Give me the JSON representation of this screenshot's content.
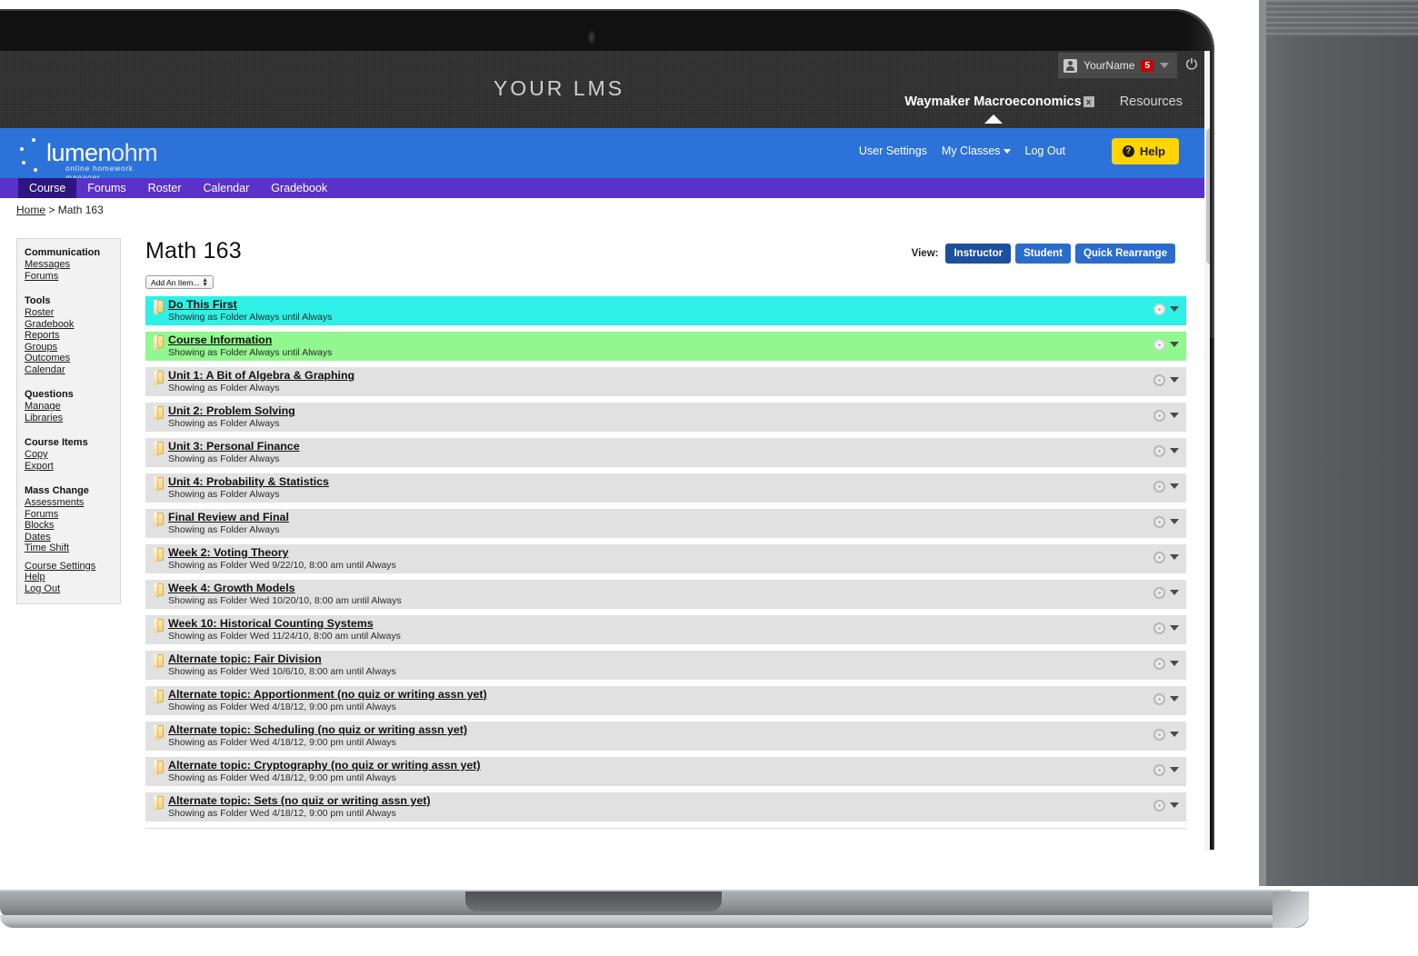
{
  "lms": {
    "title": "YOUR LMS",
    "user": {
      "name": "YourName",
      "badge": "5"
    },
    "icons": {
      "avatar": "avatar-icon",
      "power": "power-icon",
      "pin": "pin-icon",
      "caret": "chevron-down-icon"
    },
    "tabs": [
      {
        "label": "Waymaker Macroeconomics",
        "close": "x",
        "active": true
      },
      {
        "label": "Resources",
        "active": false
      }
    ]
  },
  "ohm": {
    "logo_main": "lumen",
    "logo_accent": "ohm",
    "logo_tagline": "online homework manager",
    "links": [
      {
        "label": "User Settings",
        "caret": false
      },
      {
        "label": "My Classes",
        "caret": true
      },
      {
        "label": "Log Out",
        "caret": false
      }
    ],
    "help_label": "Help"
  },
  "nav": {
    "items": [
      {
        "label": "Course",
        "active": true
      },
      {
        "label": "Forums",
        "active": false
      },
      {
        "label": "Roster",
        "active": false
      },
      {
        "label": "Calendar",
        "active": false
      },
      {
        "label": "Gradebook",
        "active": false
      }
    ]
  },
  "breadcrumb": {
    "home": "Home",
    "separator": " > ",
    "current": "Math 163"
  },
  "sidebar": {
    "groups": [
      {
        "heading": "Communication",
        "links": [
          "Messages",
          "Forums"
        ]
      },
      {
        "heading": "Tools",
        "links": [
          "Roster",
          "Gradebook",
          "Reports",
          "Groups",
          "Outcomes",
          "Calendar"
        ]
      },
      {
        "heading": "Questions",
        "links": [
          "Manage",
          "Libraries"
        ]
      },
      {
        "heading": "Course Items",
        "links": [
          "Copy",
          "Export"
        ]
      },
      {
        "heading": "Mass Change",
        "links": [
          "Assessments",
          "Forums",
          "Blocks",
          "Dates",
          "Time Shift"
        ]
      },
      {
        "heading": "",
        "links": [
          "Course Settings",
          "Help",
          "Log Out"
        ]
      }
    ]
  },
  "main": {
    "page_title": "Math 163",
    "view_label": "View:",
    "view_buttons": [
      {
        "label": "Instructor",
        "selected": true
      },
      {
        "label": "Student",
        "selected": false
      },
      {
        "label": "Quick Rearrange",
        "selected": false
      }
    ],
    "add_item": {
      "value": "Add An Item...",
      "placeholder": "Add An Item..."
    },
    "items": [
      {
        "title": "Do This First",
        "sub": "Showing as Folder Always until Always",
        "color": "cyan"
      },
      {
        "title": "Course Information",
        "sub": "Showing as Folder Always until Always",
        "color": "green"
      },
      {
        "title": "Unit 1: A Bit of Algebra & Graphing",
        "sub": "Showing as Folder Always",
        "color": ""
      },
      {
        "title": "Unit 2: Problem Solving ",
        "sub": "Showing as Folder Always",
        "color": ""
      },
      {
        "title": "Unit 3: Personal Finance",
        "sub": "Showing as Folder Always",
        "color": ""
      },
      {
        "title": "Unit 4: Probability & Statistics",
        "sub": "Showing as Folder Always",
        "color": ""
      },
      {
        "title": "Final Review and Final",
        "sub": "Showing as Folder Always",
        "color": ""
      },
      {
        "title": "Week 2: Voting Theory",
        "sub": "Showing as Folder Wed 9/22/10, 8:00 am until Always",
        "color": ""
      },
      {
        "title": "Week 4: Growth Models",
        "sub": "Showing as Folder Wed 10/20/10, 8:00 am until Always",
        "color": ""
      },
      {
        "title": "Week 10: Historical Counting Systems",
        "sub": "Showing as Folder Wed 11/24/10, 8:00 am until Always",
        "color": ""
      },
      {
        "title": "Alternate topic: Fair Division",
        "sub": "Showing as Folder Wed 10/6/10, 8:00 am until Always",
        "color": ""
      },
      {
        "title": "Alternate topic: Apportionment (no quiz or writing assn yet)",
        "sub": "Showing as Folder Wed 4/18/12, 9:00 pm until Always",
        "color": ""
      },
      {
        "title": "Alternate topic: Scheduling (no quiz or writing assn yet)",
        "sub": "Showing as Folder Wed 4/18/12, 9:00 pm until Always",
        "color": ""
      },
      {
        "title": "Alternate topic: Cryptography (no quiz or writing assn yet)",
        "sub": "Showing as Folder Wed 4/18/12, 9:00 pm until Always",
        "color": ""
      },
      {
        "title": "Alternate topic: Sets (no quiz or writing assn yet)",
        "sub": "Showing as Folder Wed 4/18/12, 9:00 pm until Always",
        "color": ""
      }
    ]
  },
  "colors": {
    "ohm_blue": "#2d72d9",
    "nav_purple": "#5b32c9",
    "nav_purple_active": "#2e1580",
    "help_yellow": "#ffd400",
    "badge_red": "#cc0000",
    "row_cyan": "#2ff0e6",
    "row_green": "#92f78f",
    "row_grey": "#e1e1e1",
    "view_blue": "#2a6ccc",
    "view_blue_selected": "#1c4f9c"
  }
}
